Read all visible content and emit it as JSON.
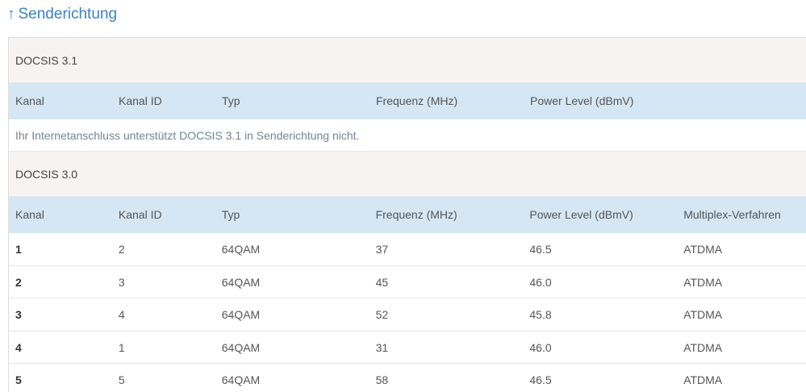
{
  "page": {
    "heading_icon": "↑",
    "heading": "Senderichtung"
  },
  "docsis31": {
    "title": "DOCSIS 3.1",
    "columns": [
      "Kanal",
      "Kanal ID",
      "Typ",
      "Frequenz (MHz)",
      "Power Level (dBmV)"
    ],
    "message": "Ihr Internetanschluss unterstützt DOCSIS 3.1 in Senderichtung nicht."
  },
  "docsis30": {
    "title": "DOCSIS 3.0",
    "columns": [
      "Kanal",
      "Kanal ID",
      "Typ",
      "Frequenz (MHz)",
      "Power Level (dBmV)",
      "Multiplex-Verfahren"
    ],
    "rows": [
      [
        "1",
        "2",
        "64QAM",
        "37",
        "46.5",
        "ATDMA"
      ],
      [
        "2",
        "3",
        "64QAM",
        "45",
        "46.0",
        "ATDMA"
      ],
      [
        "3",
        "4",
        "64QAM",
        "52",
        "45.8",
        "ATDMA"
      ],
      [
        "4",
        "1",
        "64QAM",
        "31",
        "46.0",
        "ATDMA"
      ],
      [
        "5",
        "5",
        "64QAM",
        "58",
        "46.5",
        "ATDMA"
      ]
    ]
  },
  "colors": {
    "heading": "#3a82c4",
    "header_row_bg": "#d5e7f5",
    "section_bg": "#f5f4f2",
    "message_text": "#6e8696"
  }
}
